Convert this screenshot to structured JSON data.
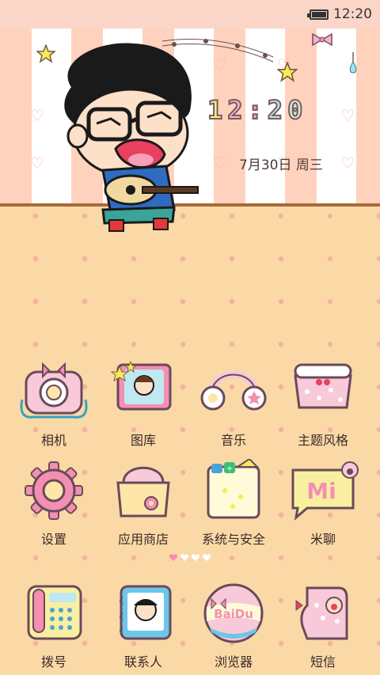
{
  "status_bar": {
    "time": "12:20",
    "battery_icon": "battery-icon"
  },
  "lockscreen": {
    "clock_digits": [
      "1",
      "2",
      ":",
      "2",
      "0"
    ],
    "date": "7月30日 周三"
  },
  "apps": [
    {
      "label": "相机",
      "icon": "camera-icon"
    },
    {
      "label": "图库",
      "icon": "gallery-icon"
    },
    {
      "label": "音乐",
      "icon": "headphones-icon"
    },
    {
      "label": "主题风格",
      "icon": "theme-icon"
    },
    {
      "label": "设置",
      "icon": "gear-icon"
    },
    {
      "label": "应用商店",
      "icon": "shop-bag-icon"
    },
    {
      "label": "系统与安全",
      "icon": "security-icon"
    },
    {
      "label": "米聊",
      "icon": "chat-icon"
    }
  ],
  "dock": [
    {
      "label": "拨号",
      "icon": "phone-icon"
    },
    {
      "label": "联系人",
      "icon": "contacts-icon"
    },
    {
      "label": "浏览器",
      "icon": "browser-icon"
    },
    {
      "label": "短信",
      "icon": "sms-icon"
    }
  ],
  "page_indicator": {
    "total": 4,
    "current": 1
  },
  "colors": {
    "accent": "#f48fb1",
    "background": "#fbd9a6",
    "status_bar": "#fbd6c8"
  }
}
